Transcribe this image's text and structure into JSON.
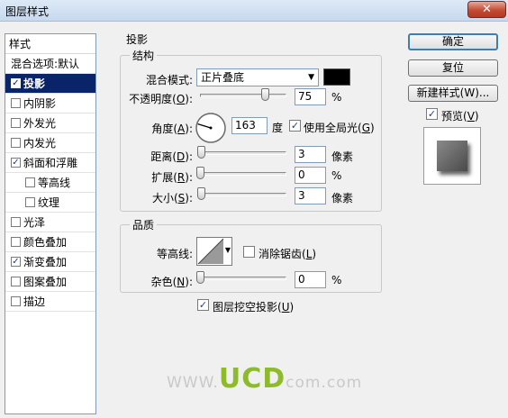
{
  "window": {
    "title": "图层样式",
    "close_label": "✕"
  },
  "styles_list": {
    "header": "样式",
    "items": [
      {
        "label": "混合选项:默认",
        "checkbox": false,
        "checked": false,
        "sub": false,
        "selected": false
      },
      {
        "label": "投影",
        "checkbox": true,
        "checked": true,
        "sub": false,
        "selected": true
      },
      {
        "label": "内阴影",
        "checkbox": true,
        "checked": false,
        "sub": false,
        "selected": false
      },
      {
        "label": "外发光",
        "checkbox": true,
        "checked": false,
        "sub": false,
        "selected": false
      },
      {
        "label": "内发光",
        "checkbox": true,
        "checked": false,
        "sub": false,
        "selected": false
      },
      {
        "label": "斜面和浮雕",
        "checkbox": true,
        "checked": true,
        "sub": false,
        "selected": false
      },
      {
        "label": "等高线",
        "checkbox": true,
        "checked": false,
        "sub": true,
        "selected": false
      },
      {
        "label": "纹理",
        "checkbox": true,
        "checked": false,
        "sub": true,
        "selected": false
      },
      {
        "label": "光泽",
        "checkbox": true,
        "checked": false,
        "sub": false,
        "selected": false
      },
      {
        "label": "颜色叠加",
        "checkbox": true,
        "checked": false,
        "sub": false,
        "selected": false
      },
      {
        "label": "渐变叠加",
        "checkbox": true,
        "checked": true,
        "sub": false,
        "selected": false
      },
      {
        "label": "图案叠加",
        "checkbox": true,
        "checked": false,
        "sub": false,
        "selected": false
      },
      {
        "label": "描边",
        "checkbox": true,
        "checked": false,
        "sub": false,
        "selected": false
      }
    ]
  },
  "drop_shadow": {
    "section_title": "投影",
    "structure": {
      "title": "结构",
      "blend_mode_label": "混合模式:",
      "blend_mode_value": "正片叠底",
      "color_swatch": "#000000",
      "opacity_label": "不透明度(O):",
      "opacity_value": "75",
      "opacity_percent": 75,
      "opacity_unit": "%",
      "angle_label": "角度(A):",
      "angle_value": "163",
      "angle_unit": "度",
      "use_global_light_label": "使用全局光(G)",
      "use_global_light": true,
      "distance_label": "距离(D):",
      "distance_value": "3",
      "distance_unit": "像素",
      "spread_label": "扩展(R):",
      "spread_value": "0",
      "spread_unit": "%",
      "size_label": "大小(S):",
      "size_value": "3",
      "size_unit": "像素"
    },
    "quality": {
      "title": "品质",
      "contour_label": "等高线:",
      "anti_aliased_label": "消除锯齿(L)",
      "anti_aliased": false,
      "noise_label": "杂色(N):",
      "noise_value": "0",
      "noise_unit": "%"
    },
    "knockout_label": "图层挖空投影(U)",
    "knockout": true
  },
  "buttons": {
    "ok": "确定",
    "reset": "复位",
    "new_style": "新建样式(W)...",
    "preview_label": "预览(V)",
    "preview_checked": true
  },
  "watermark": {
    "prefix": "WWW.",
    "brand": "UCD",
    "suffix": "com.com"
  }
}
